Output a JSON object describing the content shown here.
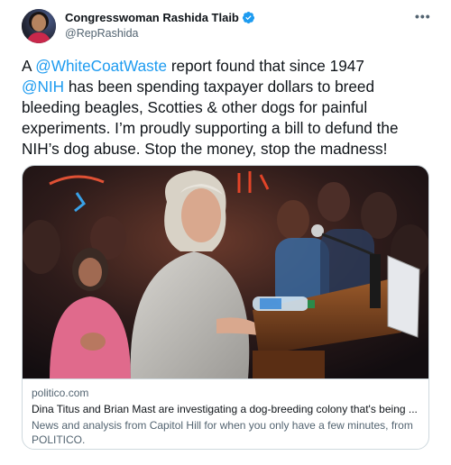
{
  "author": {
    "display_name": "Congresswoman Rashida Tlaib",
    "handle": "@RepRashida",
    "avatar_icon": "profile-photo",
    "verified_icon": "verified-badge-icon",
    "more_icon": "more-options-icon",
    "more_label": "•••"
  },
  "tweet": {
    "t1": "A ",
    "m1": "@WhiteCoatWaste",
    "t2": " report found that since 1947 ",
    "m2": "@NIH",
    "t3": " has been spending taxpayer dollars to breed bleeding beagles, Scotties & other dogs for painful experiments. I’m proudly supporting a bill to defund the NIH’s dog abuse. Stop the money, stop the madness!"
  },
  "link_card": {
    "image": "photo-speaker-at-podium",
    "domain": "politico.com",
    "title": "Dina Titus and Brian Mast are investigating a dog-breeding colony that's being ...",
    "description": "News and analysis from Capitol Hill for when you only have a few minutes, from POLITICO."
  },
  "colors": {
    "link": "#1d9bf0",
    "text": "#0f1419",
    "secondary": "#536471",
    "border": "#cfd9de"
  }
}
